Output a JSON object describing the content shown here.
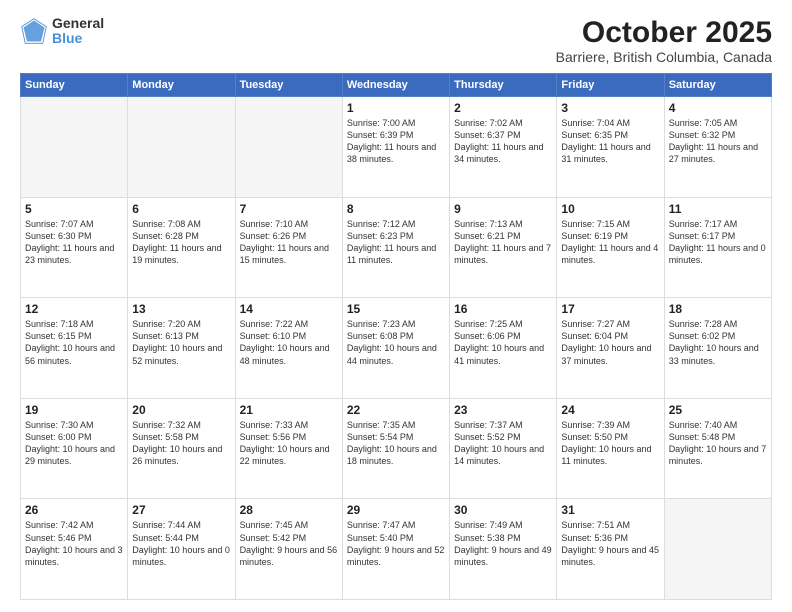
{
  "logo": {
    "general": "General",
    "blue": "Blue"
  },
  "header": {
    "title": "October 2025",
    "subtitle": "Barriere, British Columbia, Canada"
  },
  "weekdays": [
    "Sunday",
    "Monday",
    "Tuesday",
    "Wednesday",
    "Thursday",
    "Friday",
    "Saturday"
  ],
  "weeks": [
    [
      {
        "day": "",
        "empty": true
      },
      {
        "day": "",
        "empty": true
      },
      {
        "day": "",
        "empty": true
      },
      {
        "day": "1",
        "sunrise": "7:00 AM",
        "sunset": "6:39 PM",
        "daylight": "11 hours and 38 minutes."
      },
      {
        "day": "2",
        "sunrise": "7:02 AM",
        "sunset": "6:37 PM",
        "daylight": "11 hours and 34 minutes."
      },
      {
        "day": "3",
        "sunrise": "7:04 AM",
        "sunset": "6:35 PM",
        "daylight": "11 hours and 31 minutes."
      },
      {
        "day": "4",
        "sunrise": "7:05 AM",
        "sunset": "6:32 PM",
        "daylight": "11 hours and 27 minutes."
      }
    ],
    [
      {
        "day": "5",
        "sunrise": "7:07 AM",
        "sunset": "6:30 PM",
        "daylight": "11 hours and 23 minutes."
      },
      {
        "day": "6",
        "sunrise": "7:08 AM",
        "sunset": "6:28 PM",
        "daylight": "11 hours and 19 minutes."
      },
      {
        "day": "7",
        "sunrise": "7:10 AM",
        "sunset": "6:26 PM",
        "daylight": "11 hours and 15 minutes."
      },
      {
        "day": "8",
        "sunrise": "7:12 AM",
        "sunset": "6:23 PM",
        "daylight": "11 hours and 11 minutes."
      },
      {
        "day": "9",
        "sunrise": "7:13 AM",
        "sunset": "6:21 PM",
        "daylight": "11 hours and 7 minutes."
      },
      {
        "day": "10",
        "sunrise": "7:15 AM",
        "sunset": "6:19 PM",
        "daylight": "11 hours and 4 minutes."
      },
      {
        "day": "11",
        "sunrise": "7:17 AM",
        "sunset": "6:17 PM",
        "daylight": "11 hours and 0 minutes."
      }
    ],
    [
      {
        "day": "12",
        "sunrise": "7:18 AM",
        "sunset": "6:15 PM",
        "daylight": "10 hours and 56 minutes."
      },
      {
        "day": "13",
        "sunrise": "7:20 AM",
        "sunset": "6:13 PM",
        "daylight": "10 hours and 52 minutes."
      },
      {
        "day": "14",
        "sunrise": "7:22 AM",
        "sunset": "6:10 PM",
        "daylight": "10 hours and 48 minutes."
      },
      {
        "day": "15",
        "sunrise": "7:23 AM",
        "sunset": "6:08 PM",
        "daylight": "10 hours and 44 minutes."
      },
      {
        "day": "16",
        "sunrise": "7:25 AM",
        "sunset": "6:06 PM",
        "daylight": "10 hours and 41 minutes."
      },
      {
        "day": "17",
        "sunrise": "7:27 AM",
        "sunset": "6:04 PM",
        "daylight": "10 hours and 37 minutes."
      },
      {
        "day": "18",
        "sunrise": "7:28 AM",
        "sunset": "6:02 PM",
        "daylight": "10 hours and 33 minutes."
      }
    ],
    [
      {
        "day": "19",
        "sunrise": "7:30 AM",
        "sunset": "6:00 PM",
        "daylight": "10 hours and 29 minutes."
      },
      {
        "day": "20",
        "sunrise": "7:32 AM",
        "sunset": "5:58 PM",
        "daylight": "10 hours and 26 minutes."
      },
      {
        "day": "21",
        "sunrise": "7:33 AM",
        "sunset": "5:56 PM",
        "daylight": "10 hours and 22 minutes."
      },
      {
        "day": "22",
        "sunrise": "7:35 AM",
        "sunset": "5:54 PM",
        "daylight": "10 hours and 18 minutes."
      },
      {
        "day": "23",
        "sunrise": "7:37 AM",
        "sunset": "5:52 PM",
        "daylight": "10 hours and 14 minutes."
      },
      {
        "day": "24",
        "sunrise": "7:39 AM",
        "sunset": "5:50 PM",
        "daylight": "10 hours and 11 minutes."
      },
      {
        "day": "25",
        "sunrise": "7:40 AM",
        "sunset": "5:48 PM",
        "daylight": "10 hours and 7 minutes."
      }
    ],
    [
      {
        "day": "26",
        "sunrise": "7:42 AM",
        "sunset": "5:46 PM",
        "daylight": "10 hours and 3 minutes."
      },
      {
        "day": "27",
        "sunrise": "7:44 AM",
        "sunset": "5:44 PM",
        "daylight": "10 hours and 0 minutes."
      },
      {
        "day": "28",
        "sunrise": "7:45 AM",
        "sunset": "5:42 PM",
        "daylight": "9 hours and 56 minutes."
      },
      {
        "day": "29",
        "sunrise": "7:47 AM",
        "sunset": "5:40 PM",
        "daylight": "9 hours and 52 minutes."
      },
      {
        "day": "30",
        "sunrise": "7:49 AM",
        "sunset": "5:38 PM",
        "daylight": "9 hours and 49 minutes."
      },
      {
        "day": "31",
        "sunrise": "7:51 AM",
        "sunset": "5:36 PM",
        "daylight": "9 hours and 45 minutes."
      },
      {
        "day": "",
        "empty": true
      }
    ]
  ]
}
